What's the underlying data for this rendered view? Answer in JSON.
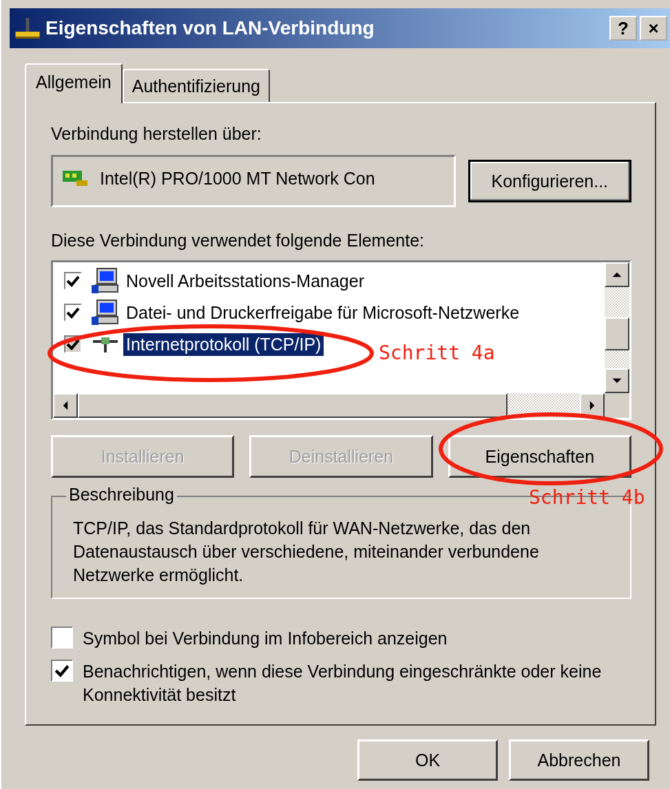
{
  "window": {
    "title": "Eigenschaften von LAN-Verbindung",
    "buttons": [
      "?",
      "×"
    ]
  },
  "tabs": [
    {
      "label": "Allgemein",
      "selected": true
    },
    {
      "label": "Authentifizierung",
      "selected": false
    }
  ],
  "connect_via": {
    "label": "Verbindung herstellen über:",
    "adapter": "Intel(R) PRO/1000 MT Network Con",
    "button": "Konfigurieren..."
  },
  "components": {
    "label": "Diese Verbindung verwendet folgende Elemente:",
    "items": [
      {
        "label": "Novell Arbeitsstations-Manager",
        "kind": "client",
        "checked": true,
        "selected": false
      },
      {
        "label": "Datei- und Druckerfreigabe für Microsoft-Netzwerke",
        "kind": "service",
        "checked": true,
        "selected": false
      },
      {
        "label": "Internetprotokoll (TCP/IP)",
        "kind": "protocol",
        "checked": true,
        "selected": true
      }
    ]
  },
  "actions": [
    {
      "label": "Installieren",
      "disabled": true
    },
    {
      "label": "Deinstallieren",
      "disabled": true
    },
    {
      "label": "Eigenschaften",
      "disabled": false
    }
  ],
  "description": {
    "title": "Beschreibung",
    "text": "TCP/IP, das Standardprotokoll für WAN-Netzwerke, das den Datenaustausch über verschiedene, miteinander verbundene Netzwerke ermöglicht."
  },
  "options": [
    {
      "label": "Symbol bei Verbindung im Infobereich anzeigen",
      "checked": false
    },
    {
      "label": "Benachrichtigen, wenn diese Verbindung eingeschränkte oder keine Konnektivität besitzt",
      "checked": true
    }
  ],
  "footer_buttons": [
    "OK",
    "Abbrechen"
  ],
  "annotations": [
    {
      "text": "Schritt 4a"
    },
    {
      "text": "Schritt 4b"
    }
  ]
}
